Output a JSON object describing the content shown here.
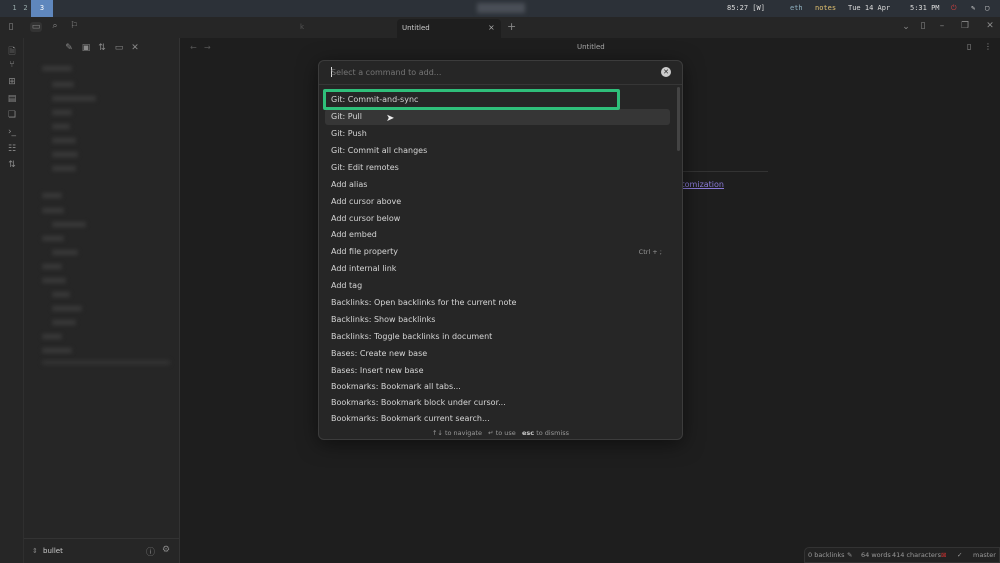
{
  "topbar": {
    "workspaces": [
      "1",
      "2",
      "3"
    ],
    "active_workspace": "3",
    "battery": "85:27 [W]",
    "network": "eth",
    "mode": "notes",
    "date": "Tue 14 Apr",
    "time": "5:31 PM"
  },
  "tabs": {
    "active": "Untitled",
    "other": "k",
    "new_tab": "+",
    "close": "×"
  },
  "header": {
    "title": "Untitled"
  },
  "editor": {
    "link_fragment": "tomization"
  },
  "palette": {
    "placeholder": "Select a command to add...",
    "items": [
      {
        "label": "Git: Commit-and-sync"
      },
      {
        "label": "Git: Pull"
      },
      {
        "label": "Git: Push"
      },
      {
        "label": "Git: Commit all changes"
      },
      {
        "label": "Git: Edit remotes"
      },
      {
        "label": "Add alias"
      },
      {
        "label": "Add cursor above"
      },
      {
        "label": "Add cursor below"
      },
      {
        "label": "Add embed"
      },
      {
        "label": "Add file property",
        "hotkey": "Ctrl + ;"
      },
      {
        "label": "Add internal link"
      },
      {
        "label": "Add tag"
      },
      {
        "label": "Backlinks: Open backlinks for the current note"
      },
      {
        "label": "Backlinks: Show backlinks"
      },
      {
        "label": "Backlinks: Toggle backlinks in document"
      },
      {
        "label": "Bases: Create new base"
      },
      {
        "label": "Bases: Insert new base"
      },
      {
        "label": "Bookmarks: Bookmark all tabs..."
      },
      {
        "label": "Bookmarks: Bookmark block under cursor..."
      },
      {
        "label": "Bookmarks: Bookmark current search..."
      }
    ],
    "highlight_color": "#2fbf7a",
    "footer": {
      "navigate_keys": "↑↓",
      "navigate": "to navigate",
      "use_key": "↵",
      "use": "to use",
      "dismiss_key": "esc",
      "dismiss": "to dismiss"
    }
  },
  "sidebar": {
    "vault": "bullet"
  },
  "status": {
    "backlinks": "0 backlinks",
    "words": "64 words",
    "characters": "414 characters",
    "branch": "master"
  }
}
